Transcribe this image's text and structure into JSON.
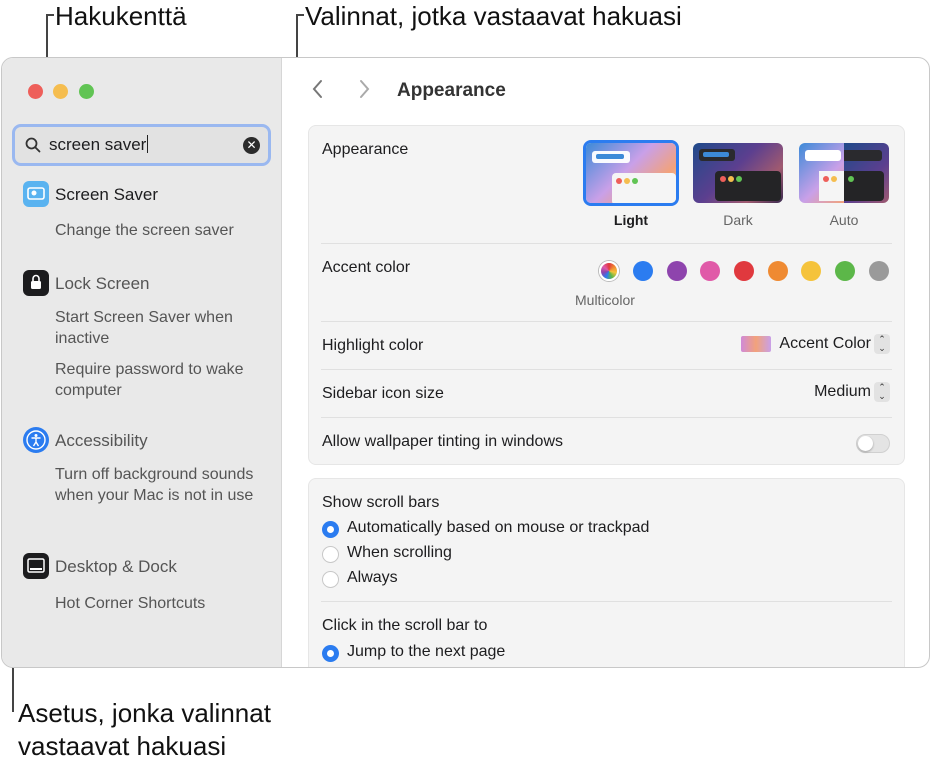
{
  "callouts": {
    "search_field": "Hakukenttä",
    "matching_options": "Valinnat, jotka vastaavat hakuasi",
    "setting_line1": "Asetus, jonka valinnat",
    "setting_line2": "vastaavat hakuasi"
  },
  "search": {
    "value": "screen saver",
    "icon": "search-icon"
  },
  "sidebar": {
    "results": [
      {
        "category": "Screen Saver",
        "icon": "screen-saver-icon",
        "subs": [
          "Change the screen saver"
        ]
      },
      {
        "category": "Lock Screen",
        "icon": "lock-icon",
        "subs": [
          "Start Screen Saver when inactive",
          "Require password to wake computer"
        ]
      },
      {
        "category": "Accessibility",
        "icon": "accessibility-icon",
        "subs": [
          "Turn off background sounds when your Mac is not in use"
        ]
      },
      {
        "category": "Desktop & Dock",
        "icon": "desktop-dock-icon",
        "subs": [
          "Hot Corner Shortcuts"
        ]
      }
    ]
  },
  "main": {
    "title": "Appearance",
    "appearance": {
      "label": "Appearance",
      "options": [
        "Light",
        "Dark",
        "Auto"
      ],
      "selected": "Light"
    },
    "accent": {
      "label": "Accent color",
      "multicolor_label": "Multicolor",
      "colors": [
        "#2b7cf0",
        "#8e44ad",
        "#e05aa8",
        "#e0393e",
        "#ef8a32",
        "#f5c33b",
        "#5cb749",
        "#9a9a9a"
      ]
    },
    "highlight": {
      "label": "Highlight color",
      "value": "Accent Color"
    },
    "sidebar_icon": {
      "label": "Sidebar icon size",
      "value": "Medium"
    },
    "tinting": {
      "label": "Allow wallpaper tinting in windows",
      "enabled": false
    },
    "scrollbars": {
      "label": "Show scroll bars",
      "options": [
        "Automatically based on mouse or trackpad",
        "When scrolling",
        "Always"
      ],
      "selected": 0
    },
    "click_scroll": {
      "label": "Click in the scroll bar to",
      "options": [
        "Jump to the next page"
      ],
      "selected": 0
    }
  }
}
